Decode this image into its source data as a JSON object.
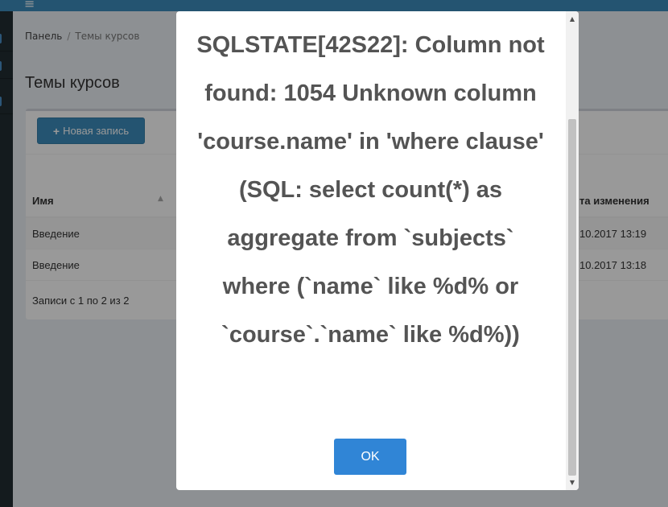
{
  "topbar": {
    "menu_icon": "hamburger-icon",
    "menu_glyph": "≡"
  },
  "breadcrumb": {
    "items": [
      "Панель",
      "Темы курсов"
    ],
    "separator": "/"
  },
  "page": {
    "title": "Темы курсов"
  },
  "toolbar": {
    "add_label": "Новая запись",
    "add_icon": "plus-icon",
    "add_glyph": "+"
  },
  "table": {
    "columns": [
      "Имя",
      "та изменения"
    ],
    "sort_glyph": "▲",
    "rows": [
      {
        "name": "Введение",
        "changed": "10.2017 13:19"
      },
      {
        "name": "Введение",
        "changed": "10.2017 13:18"
      }
    ],
    "info": "Записи с 1 по 2 из 2"
  },
  "modal": {
    "message": "SQLSTATE[42S22]: Column not found: 1054 Unknown column 'course.name' in 'where clause' (SQL: select count(*) as aggregate from `subjects` where (`name` like %d% or `course`.`name` like %d%))",
    "ok_label": "OK",
    "scroll_up_glyph": "▲",
    "scroll_down_glyph": "▼"
  },
  "colors": {
    "accent": "#3c8dbc",
    "ok_button": "#3085d6",
    "sidebar": "#222d32"
  }
}
